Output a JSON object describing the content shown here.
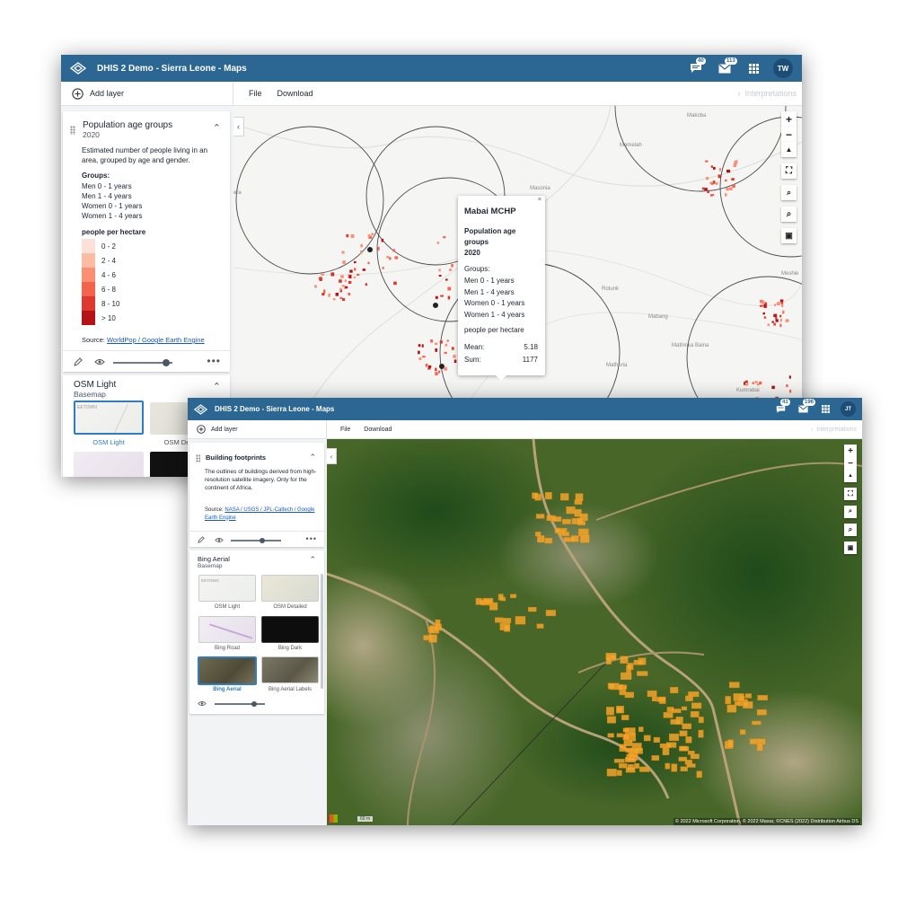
{
  "win1": {
    "title": "DHIS 2 Demo - Sierra Leone - Maps",
    "badges": {
      "interpretations": "40",
      "messages": "113"
    },
    "avatar": "TW",
    "toolbar": {
      "add_layer": "Add layer",
      "file": "File",
      "download": "Download",
      "interpretations": "Interpretations"
    },
    "layer": {
      "title": "Population age groups",
      "period": "2020",
      "description": "Estimated number of people living in an area, grouped by age and gender.",
      "groups_label": "Groups:",
      "groups": [
        "Men 0 - 1 years",
        "Men 1 - 4 years",
        "Women 0 - 1 years",
        "Women 1 - 4 years"
      ],
      "legend_title": "people per hectare",
      "legend": [
        {
          "label": "0 - 2",
          "color": "#fde0d7"
        },
        {
          "label": "2 - 4",
          "color": "#fcbba3"
        },
        {
          "label": "4 - 6",
          "color": "#fb8f74"
        },
        {
          "label": "6 - 8",
          "color": "#f4634c"
        },
        {
          "label": "8 - 10",
          "color": "#dc3a2f"
        },
        {
          "label": "> 10",
          "color": "#b41217"
        }
      ],
      "source_label": "Source:",
      "source_link": "WorldPop / Google Earth Engine",
      "opacity": 0.9
    },
    "basemap": {
      "title": "OSM Light",
      "subtitle": "Basemap",
      "options": [
        "OSM Light",
        "OSM De"
      ],
      "thumb_text": "EETOWN"
    },
    "map_labels": [
      "Makoba",
      "Mamelah",
      "Masonia",
      "Rotunk",
      "Mabang",
      "Matheria",
      "Mathinka Baina",
      "Kumrabai",
      "Kumrabai",
      "Meshie",
      "era"
    ],
    "popup": {
      "title": "Mabai MCHP",
      "layer": "Population age groups",
      "period": "2020",
      "groups_label": "Groups:",
      "groups": [
        "Men 0 - 1 years",
        "Men 1 - 4 years",
        "Women 0 - 1 years",
        "Women 1 - 4 years"
      ],
      "unit": "people per hectare",
      "mean_label": "Mean:",
      "mean": "5.18",
      "sum_label": "Sum:",
      "sum": "1177",
      "close": "×"
    }
  },
  "win2": {
    "title": "DHIS 2 Demo - Sierra Leone - Maps",
    "badges": {
      "interpretations": "41",
      "messages": "196"
    },
    "avatar": "JT",
    "toolbar": {
      "add_layer": "Add layer",
      "file": "File",
      "download": "Download",
      "interpretations": "Interpretations"
    },
    "layer": {
      "title": "Building footprints",
      "description": "The outlines of buildings derived from high-resolution satellite imagery. Only for the continent of Africa.",
      "source_label": "Source:",
      "source_link": "NASA / USGS / JPL-Caltech / Google Earth Engine",
      "opacity": 0.65
    },
    "basemap": {
      "title": "Bing Aerial",
      "subtitle": "Basemap",
      "options": [
        "OSM Light",
        "OSM Detailed",
        "Bing Road",
        "Bing Dark",
        "Bing Aerial",
        "Bing Aerial Labels"
      ],
      "selected": "Bing Aerial",
      "thumb_text": "EETOWN",
      "opacity": 0.8
    },
    "attribution": "© 2022 Microsoft Corporation, © 2022 Maxar, ©CNES (2022) Distribution Airbus DS",
    "scale": "60 m"
  },
  "colors": {
    "header": "#2c6693",
    "accent": "#2f7dc0",
    "building": "#f2a52c",
    "circle": "#4a4a4a",
    "link": "#1458c4"
  },
  "icons": {
    "logo": "dhis2-logo-icon",
    "interpretations": "chat-icon",
    "messages": "envelope-icon",
    "apps": "apps-grid-icon",
    "add": "plus-circle-icon",
    "drag": "drag-handle-icon",
    "edit": "pencil-icon",
    "visibility": "eye-icon",
    "more": "more-icon"
  }
}
